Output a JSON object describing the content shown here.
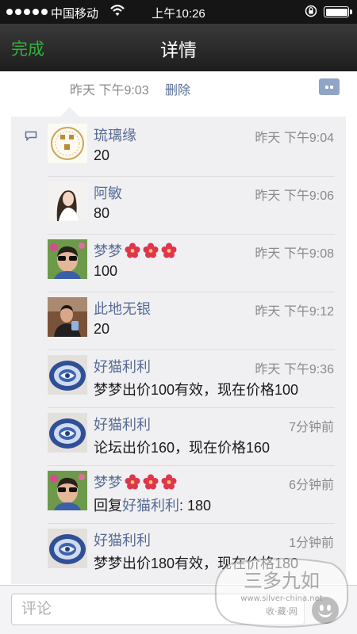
{
  "status_bar": {
    "carrier": "中国移动",
    "time": "上午10:26"
  },
  "nav": {
    "done_label": "完成",
    "title": "详情"
  },
  "post": {
    "timestamp": "昨天 下午9:03",
    "delete_label": "删除"
  },
  "comments": [
    {
      "name": "琉璃缘",
      "time": "昨天 下午9:04",
      "text": "20",
      "flowers": 0,
      "avatar": "logo"
    },
    {
      "name": "阿敏",
      "time": "昨天 下午9:06",
      "text": "80",
      "flowers": 0,
      "avatar": "woman"
    },
    {
      "name": "梦梦",
      "time": "昨天 下午9:08",
      "text": "100",
      "flowers": 3,
      "avatar": "sunglasses"
    },
    {
      "name": "此地无银",
      "time": "昨天 下午9:12",
      "text": "20",
      "flowers": 0,
      "avatar": "man"
    },
    {
      "name": "好猫利利",
      "time": "昨天 下午9:36",
      "text": "梦梦出价100有效，现在价格100",
      "flowers": 0,
      "avatar": "plate"
    },
    {
      "name": "好猫利利",
      "time": "7分钟前",
      "text": "论坛出价160，现在价格160",
      "flowers": 0,
      "avatar": "plate"
    },
    {
      "name": "梦梦",
      "time": "6分钟前",
      "reply_prefix": "回复",
      "reply_to": "好猫利利",
      "text": ": 180",
      "flowers": 3,
      "avatar": "sunglasses"
    },
    {
      "name": "好猫利利",
      "time": "1分钟前",
      "text": "梦梦出价180有效，现在价格180",
      "flowers": 0,
      "avatar": "plate"
    }
  ],
  "input": {
    "placeholder": "评论"
  },
  "watermark": {
    "title": "三多九如",
    "url": "www.silver-china.net",
    "subtitle": "收·藏·网"
  },
  "colors": {
    "accent_green": "#2fb43b",
    "link_blue": "#576b95",
    "nav_bg": "#262626",
    "panel_bg": "#f0f0f2"
  },
  "icons": [
    "signal-dots-icon",
    "wifi-icon",
    "rotation-lock-icon",
    "battery-icon",
    "comment-action-icon",
    "comment-bubble-icon",
    "flower-emoji-icon",
    "emoji-face-icon"
  ]
}
